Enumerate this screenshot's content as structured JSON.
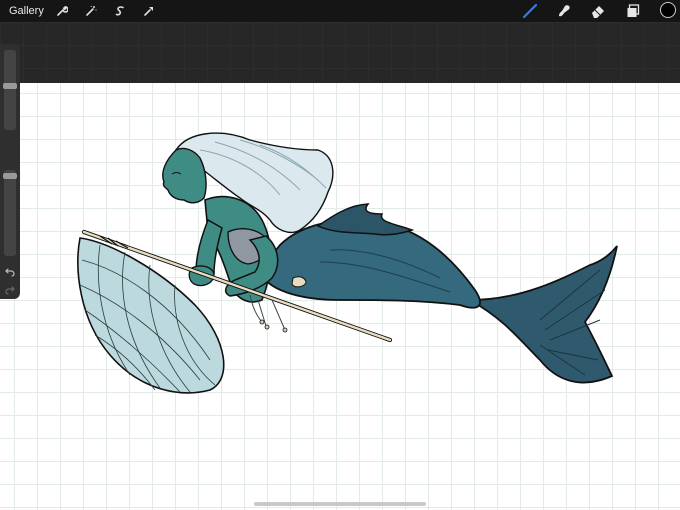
{
  "topbar": {
    "gallery_label": "Gallery",
    "left_tools": [
      "wrench-icon",
      "magic-wand-icon",
      "selection-icon",
      "transform-icon"
    ],
    "right_tools": [
      "brush-icon",
      "smudge-icon",
      "eraser-icon",
      "layers-icon"
    ],
    "active_tool": "brush-icon",
    "active_color": "#000000"
  },
  "sidebar": {
    "brush_size": 0.56,
    "opacity": 0.96,
    "buttons": [
      "modify-square-icon",
      "undo-icon",
      "redo-icon"
    ]
  },
  "canvas": {
    "background": "#ffffff",
    "grid_color": "#e3ebe8"
  },
  "colors": {
    "accent_blue": "#2f7df6",
    "skin": "#3f8c85",
    "tail": "#2f5f73",
    "hair": "#dbe9ee",
    "net_fill": "#bcd9de"
  }
}
